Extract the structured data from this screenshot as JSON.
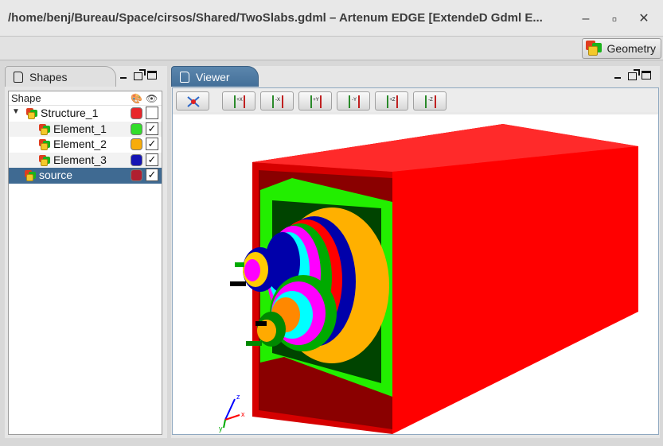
{
  "window": {
    "title": "/home/benj/Bureau/Space/cirsos/Shared/TwoSlabs.gdml – Artenum EDGE [ExtendeD Gdml E...",
    "controls": {
      "minimize": "–",
      "maximize": "▫",
      "close": "✕"
    }
  },
  "perspective": {
    "label": "Geometry"
  },
  "shapes_panel": {
    "tab_label": "Shapes",
    "header": "Shape",
    "rows": [
      {
        "label": "Structure_1",
        "color": "#e8262a",
        "checked": false,
        "expanded": true
      },
      {
        "label": "Element_1",
        "color": "#32dd2a",
        "checked": true
      },
      {
        "label": "Element_2",
        "color": "#f7ac0a",
        "checked": true
      },
      {
        "label": "Element_3",
        "color": "#1414b4",
        "checked": true
      },
      {
        "label": "source",
        "color": "#b02030",
        "checked": true,
        "selected": true
      }
    ],
    "check_mark": "✓"
  },
  "viewer_panel": {
    "tab_label": "Viewer",
    "toolbar": [
      {
        "name": "reset-view",
        "text": ""
      },
      {
        "name": "view-plus-x",
        "text": "+X"
      },
      {
        "name": "view-minus-x",
        "text": "-X"
      },
      {
        "name": "view-plus-y",
        "text": "+Y"
      },
      {
        "name": "view-minus-y",
        "text": "-Y"
      },
      {
        "name": "view-plus-z",
        "text": "+Z"
      },
      {
        "name": "view-minus-z",
        "text": "-Z"
      }
    ],
    "axis_labels": {
      "x": "x",
      "y": "y",
      "z": "z"
    }
  },
  "colors": {
    "slab_red": "#ff0000",
    "slab_green": "#22ee00",
    "orange": "#ffb000",
    "blue": "#0000aa",
    "selection": "#3f6a92"
  }
}
